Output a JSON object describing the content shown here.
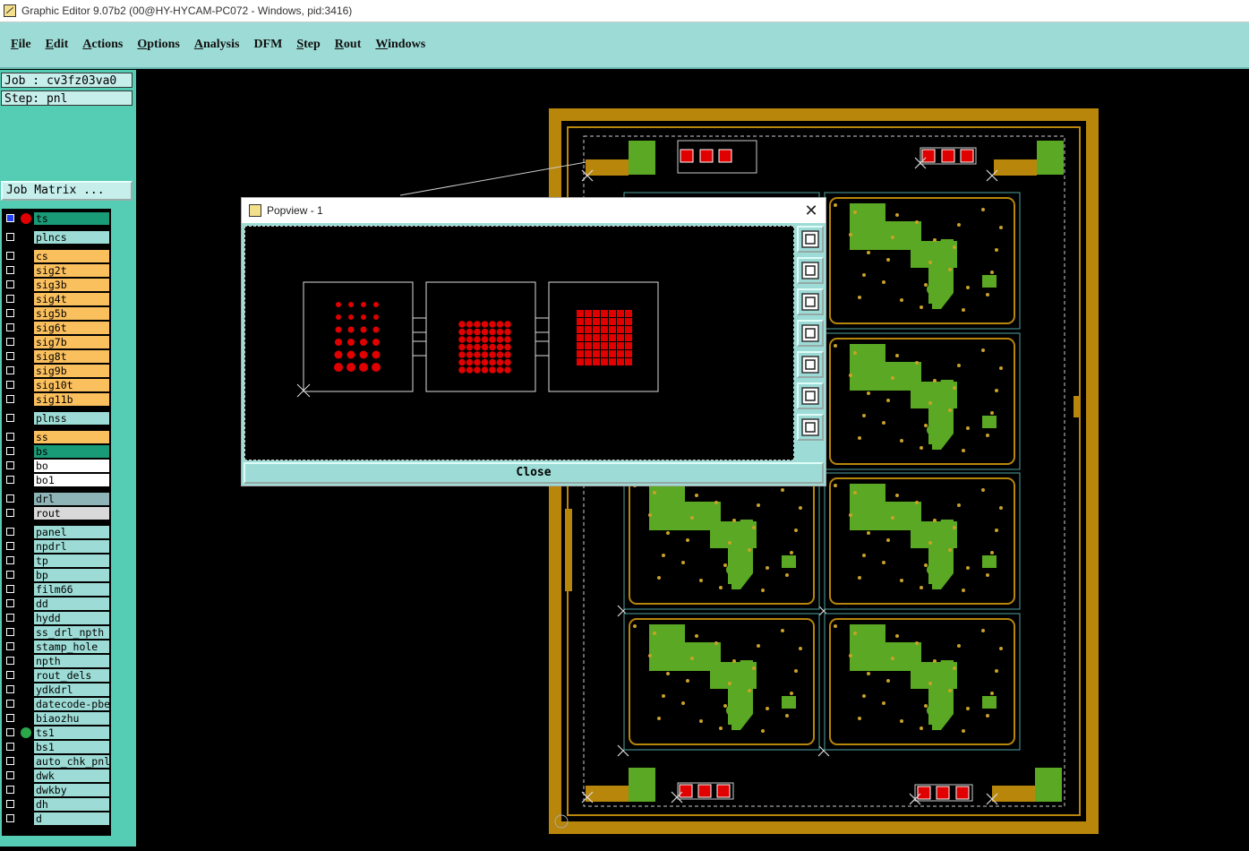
{
  "window": {
    "title": "Graphic Editor 9.07b2 (00@HY-HYCAM-PC072 - Windows, pid:3416)"
  },
  "menu": [
    {
      "label": "File",
      "underline": "F",
      "rest": "ile"
    },
    {
      "label": "Edit",
      "underline": "E",
      "rest": "dit"
    },
    {
      "label": "Actions",
      "underline": "A",
      "rest": "ctions"
    },
    {
      "label": "Options",
      "underline": "O",
      "rest": "ptions"
    },
    {
      "label": "Analysis",
      "underline": "A",
      "rest": "nalysis"
    },
    {
      "label": "DFM",
      "underline": "",
      "rest": "DFM"
    },
    {
      "label": "Step",
      "underline": "S",
      "rest": "tep"
    },
    {
      "label": "Rout",
      "underline": "R",
      "rest": "out"
    },
    {
      "label": "Windows",
      "underline": "W",
      "rest": "indows"
    }
  ],
  "job": {
    "job_text": "Job : cv3fz03va0",
    "step_text": "Step: pnl",
    "matrix_button": "Job Matrix ..."
  },
  "layers": [
    {
      "name": "ts",
      "color": "#1a9b78",
      "active": true,
      "dot": "#e00000"
    },
    {
      "name": "plncs",
      "color": "#9ddcd6"
    },
    {
      "name": "cs",
      "color": "#fbc05e"
    },
    {
      "name": "sig2t",
      "color": "#fbc05e"
    },
    {
      "name": "sig3b",
      "color": "#fbc05e"
    },
    {
      "name": "sig4t",
      "color": "#fbc05e"
    },
    {
      "name": "sig5b",
      "color": "#fbc05e"
    },
    {
      "name": "sig6t",
      "color": "#fbc05e"
    },
    {
      "name": "sig7b",
      "color": "#fbc05e"
    },
    {
      "name": "sig8t",
      "color": "#fbc05e"
    },
    {
      "name": "sig9b",
      "color": "#fbc05e"
    },
    {
      "name": "sig10t",
      "color": "#fbc05e"
    },
    {
      "name": "sig11b",
      "color": "#fbc05e"
    },
    {
      "name": "plnss",
      "color": "#9ddcd6"
    },
    {
      "name": "ss",
      "color": "#fbc05e"
    },
    {
      "name": "bs",
      "color": "#1a9b78"
    },
    {
      "name": "bo",
      "color": "#ffffff"
    },
    {
      "name": "bo1",
      "color": "#ffffff"
    },
    {
      "name": "drl",
      "color": "#8fb4b8"
    },
    {
      "name": "rout",
      "color": "#d9d9d9"
    },
    {
      "name": "panel",
      "color": "#9ddcd6"
    },
    {
      "name": "npdrl",
      "color": "#9ddcd6"
    },
    {
      "name": "tp",
      "color": "#9ddcd6"
    },
    {
      "name": "bp",
      "color": "#9ddcd6"
    },
    {
      "name": "film66",
      "color": "#9ddcd6"
    },
    {
      "name": "dd",
      "color": "#9ddcd6"
    },
    {
      "name": "hydd",
      "color": "#9ddcd6"
    },
    {
      "name": "ss_drl_npth",
      "color": "#9ddcd6"
    },
    {
      "name": "stamp_hole",
      "color": "#9ddcd6"
    },
    {
      "name": "npth",
      "color": "#9ddcd6"
    },
    {
      "name": "rout_dels",
      "color": "#9ddcd6"
    },
    {
      "name": "ydkdrl",
      "color": "#9ddcd6"
    },
    {
      "name": "datecode-pbe",
      "color": "#9ddcd6"
    },
    {
      "name": "biaozhu",
      "color": "#9ddcd6"
    },
    {
      "name": "ts1",
      "color": "#9ddcd6",
      "dot": "#2aa84a"
    },
    {
      "name": "bs1",
      "color": "#9ddcd6"
    },
    {
      "name": "auto_chk_pnl",
      "color": "#9ddcd6"
    },
    {
      "name": "dwk",
      "color": "#9ddcd6"
    },
    {
      "name": "dwkby",
      "color": "#9ddcd6"
    },
    {
      "name": "dh",
      "color": "#9ddcd6"
    },
    {
      "name": "d",
      "color": "#9ddcd6"
    }
  ],
  "colors": {
    "panel_bg": "#55cdb4",
    "menu_bg": "#9ddcd6",
    "board_gold": "#b8860b",
    "copper_green": "#5aa823",
    "pad_red": "#e00000"
  },
  "popview": {
    "title": "Popview - 1",
    "close_label": "Close",
    "tools": [
      "zoom-fit-icon",
      "zoom-in-icon",
      "zoom-out-icon",
      "pan-left-icon",
      "pan-right-icon",
      "zoom-area-icon",
      "zoom-home-icon"
    ]
  }
}
